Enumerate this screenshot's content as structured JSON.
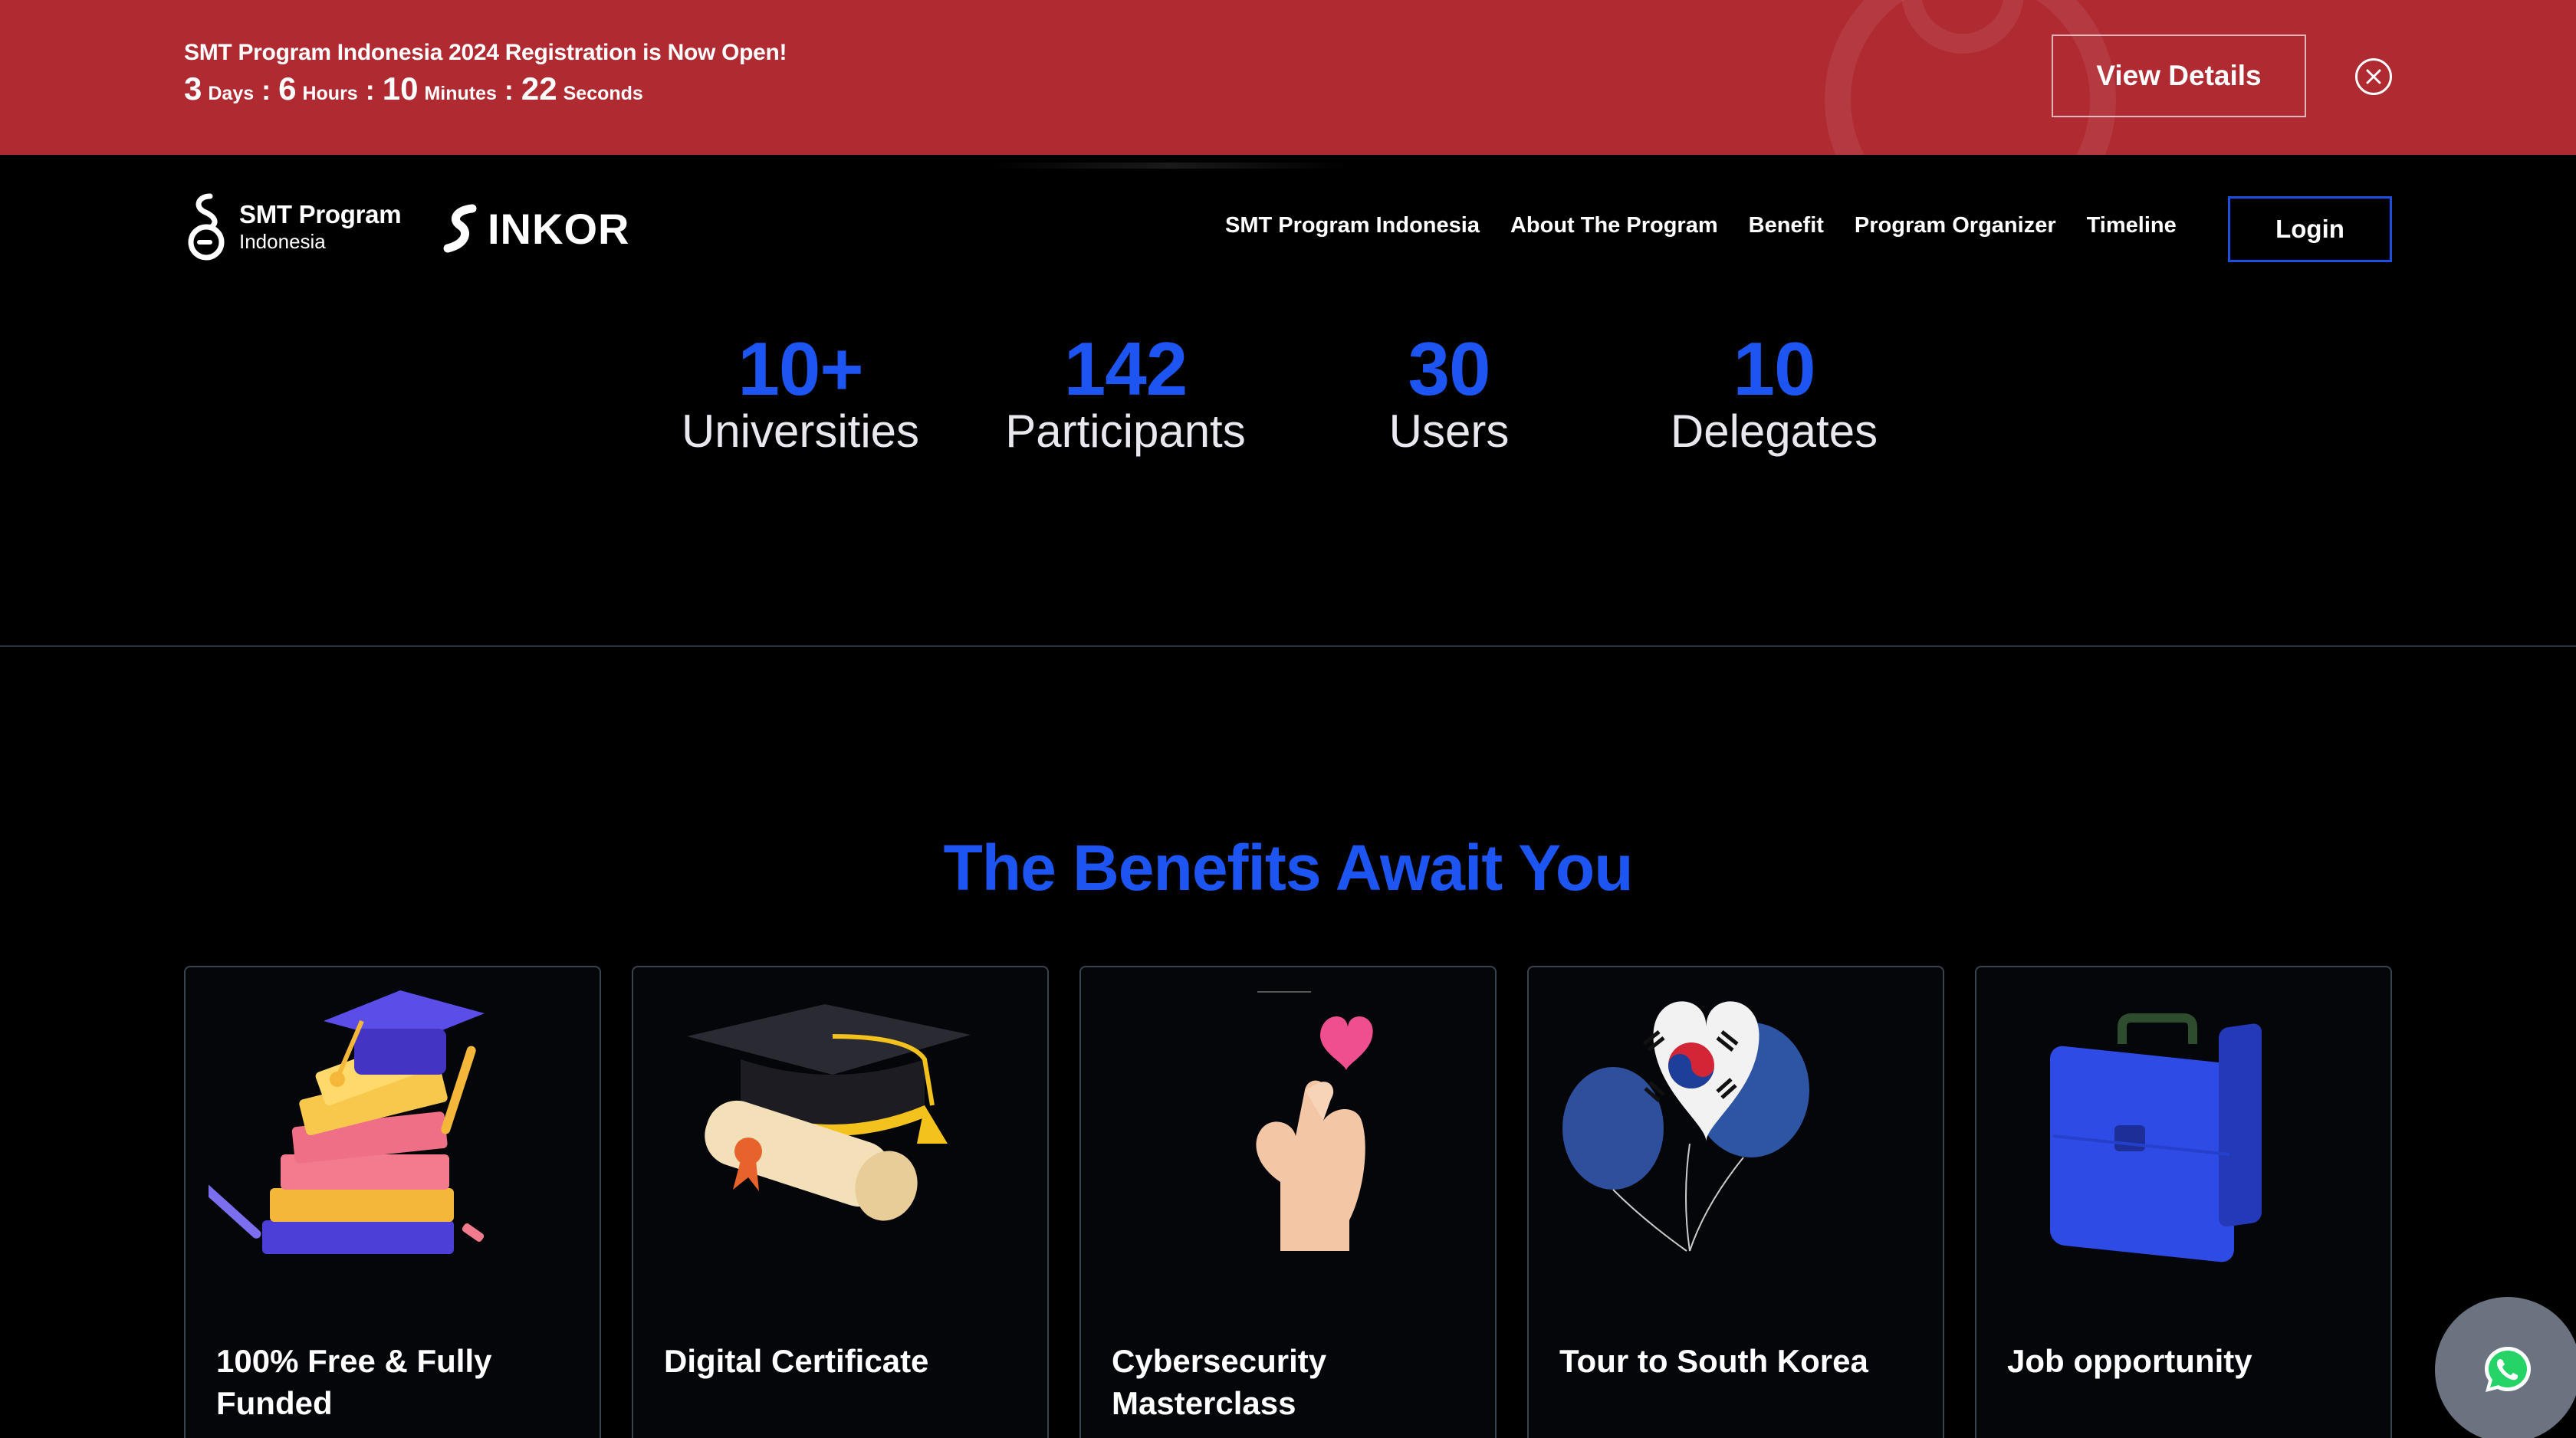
{
  "banner": {
    "title": "SMT Program Indonesia 2024 Registration is Now Open!",
    "countdown": {
      "days": "3",
      "days_label": "Days",
      "hours": "6",
      "hours_label": "Hours",
      "minutes": "10",
      "minutes_label": "Minutes",
      "seconds": "22",
      "seconds_label": "Seconds"
    },
    "view_details_label": "View Details"
  },
  "header": {
    "smt_logo": {
      "main": "SMT Program",
      "sub": "Indonesia"
    },
    "inkor_logo": "INKOR",
    "nav": [
      {
        "label": "SMT Program Indonesia"
      },
      {
        "label": "About The Program"
      },
      {
        "label": "Benefit"
      },
      {
        "label": "Program Organizer"
      },
      {
        "label": "Timeline"
      }
    ],
    "login_label": "Login"
  },
  "stats": [
    {
      "value": "10+",
      "label": "Universities"
    },
    {
      "value": "142",
      "label": "Participants"
    },
    {
      "value": "30",
      "label": "Users"
    },
    {
      "value": "10",
      "label": "Delegates"
    }
  ],
  "benefits": {
    "title": "The Benefits Await You",
    "cards": [
      {
        "title": "100% Free & Fully Funded",
        "icon": "books-graduation-icon"
      },
      {
        "title": "Digital Certificate",
        "icon": "graduation-cap-diploma-icon"
      },
      {
        "title": "Cybersecurity Masterclass",
        "icon": "finger-heart-icon"
      },
      {
        "title": "Tour to South Korea",
        "icon": "korea-balloons-icon"
      },
      {
        "title": "Job opportunity",
        "icon": "briefcase-icon"
      }
    ]
  },
  "whatsapp_icon": "whatsapp-icon",
  "colors": {
    "banner_bg": "#b02a32",
    "accent_blue": "#1d55f2",
    "page_bg": "#000000"
  }
}
